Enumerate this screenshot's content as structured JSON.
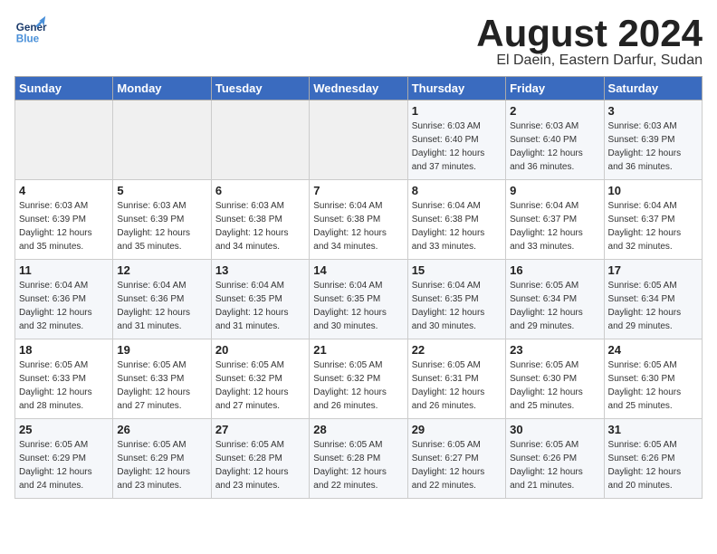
{
  "header": {
    "logo_general": "General",
    "logo_blue": "Blue",
    "month_title": "August 2024",
    "location": "El Daein, Eastern Darfur, Sudan"
  },
  "days_of_week": [
    "Sunday",
    "Monday",
    "Tuesday",
    "Wednesday",
    "Thursday",
    "Friday",
    "Saturday"
  ],
  "weeks": [
    {
      "row_bg": "light",
      "days": [
        {
          "num": "",
          "info": ""
        },
        {
          "num": "",
          "info": ""
        },
        {
          "num": "",
          "info": ""
        },
        {
          "num": "",
          "info": ""
        },
        {
          "num": "1",
          "info": "Sunrise: 6:03 AM\nSunset: 6:40 PM\nDaylight: 12 hours\nand 37 minutes."
        },
        {
          "num": "2",
          "info": "Sunrise: 6:03 AM\nSunset: 6:40 PM\nDaylight: 12 hours\nand 36 minutes."
        },
        {
          "num": "3",
          "info": "Sunrise: 6:03 AM\nSunset: 6:39 PM\nDaylight: 12 hours\nand 36 minutes."
        }
      ]
    },
    {
      "row_bg": "white",
      "days": [
        {
          "num": "4",
          "info": "Sunrise: 6:03 AM\nSunset: 6:39 PM\nDaylight: 12 hours\nand 35 minutes."
        },
        {
          "num": "5",
          "info": "Sunrise: 6:03 AM\nSunset: 6:39 PM\nDaylight: 12 hours\nand 35 minutes."
        },
        {
          "num": "6",
          "info": "Sunrise: 6:03 AM\nSunset: 6:38 PM\nDaylight: 12 hours\nand 34 minutes."
        },
        {
          "num": "7",
          "info": "Sunrise: 6:04 AM\nSunset: 6:38 PM\nDaylight: 12 hours\nand 34 minutes."
        },
        {
          "num": "8",
          "info": "Sunrise: 6:04 AM\nSunset: 6:38 PM\nDaylight: 12 hours\nand 33 minutes."
        },
        {
          "num": "9",
          "info": "Sunrise: 6:04 AM\nSunset: 6:37 PM\nDaylight: 12 hours\nand 33 minutes."
        },
        {
          "num": "10",
          "info": "Sunrise: 6:04 AM\nSunset: 6:37 PM\nDaylight: 12 hours\nand 32 minutes."
        }
      ]
    },
    {
      "row_bg": "light",
      "days": [
        {
          "num": "11",
          "info": "Sunrise: 6:04 AM\nSunset: 6:36 PM\nDaylight: 12 hours\nand 32 minutes."
        },
        {
          "num": "12",
          "info": "Sunrise: 6:04 AM\nSunset: 6:36 PM\nDaylight: 12 hours\nand 31 minutes."
        },
        {
          "num": "13",
          "info": "Sunrise: 6:04 AM\nSunset: 6:35 PM\nDaylight: 12 hours\nand 31 minutes."
        },
        {
          "num": "14",
          "info": "Sunrise: 6:04 AM\nSunset: 6:35 PM\nDaylight: 12 hours\nand 30 minutes."
        },
        {
          "num": "15",
          "info": "Sunrise: 6:04 AM\nSunset: 6:35 PM\nDaylight: 12 hours\nand 30 minutes."
        },
        {
          "num": "16",
          "info": "Sunrise: 6:05 AM\nSunset: 6:34 PM\nDaylight: 12 hours\nand 29 minutes."
        },
        {
          "num": "17",
          "info": "Sunrise: 6:05 AM\nSunset: 6:34 PM\nDaylight: 12 hours\nand 29 minutes."
        }
      ]
    },
    {
      "row_bg": "white",
      "days": [
        {
          "num": "18",
          "info": "Sunrise: 6:05 AM\nSunset: 6:33 PM\nDaylight: 12 hours\nand 28 minutes."
        },
        {
          "num": "19",
          "info": "Sunrise: 6:05 AM\nSunset: 6:33 PM\nDaylight: 12 hours\nand 27 minutes."
        },
        {
          "num": "20",
          "info": "Sunrise: 6:05 AM\nSunset: 6:32 PM\nDaylight: 12 hours\nand 27 minutes."
        },
        {
          "num": "21",
          "info": "Sunrise: 6:05 AM\nSunset: 6:32 PM\nDaylight: 12 hours\nand 26 minutes."
        },
        {
          "num": "22",
          "info": "Sunrise: 6:05 AM\nSunset: 6:31 PM\nDaylight: 12 hours\nand 26 minutes."
        },
        {
          "num": "23",
          "info": "Sunrise: 6:05 AM\nSunset: 6:30 PM\nDaylight: 12 hours\nand 25 minutes."
        },
        {
          "num": "24",
          "info": "Sunrise: 6:05 AM\nSunset: 6:30 PM\nDaylight: 12 hours\nand 25 minutes."
        }
      ]
    },
    {
      "row_bg": "light",
      "days": [
        {
          "num": "25",
          "info": "Sunrise: 6:05 AM\nSunset: 6:29 PM\nDaylight: 12 hours\nand 24 minutes."
        },
        {
          "num": "26",
          "info": "Sunrise: 6:05 AM\nSunset: 6:29 PM\nDaylight: 12 hours\nand 23 minutes."
        },
        {
          "num": "27",
          "info": "Sunrise: 6:05 AM\nSunset: 6:28 PM\nDaylight: 12 hours\nand 23 minutes."
        },
        {
          "num": "28",
          "info": "Sunrise: 6:05 AM\nSunset: 6:28 PM\nDaylight: 12 hours\nand 22 minutes."
        },
        {
          "num": "29",
          "info": "Sunrise: 6:05 AM\nSunset: 6:27 PM\nDaylight: 12 hours\nand 22 minutes."
        },
        {
          "num": "30",
          "info": "Sunrise: 6:05 AM\nSunset: 6:26 PM\nDaylight: 12 hours\nand 21 minutes."
        },
        {
          "num": "31",
          "info": "Sunrise: 6:05 AM\nSunset: 6:26 PM\nDaylight: 12 hours\nand 20 minutes."
        }
      ]
    }
  ]
}
